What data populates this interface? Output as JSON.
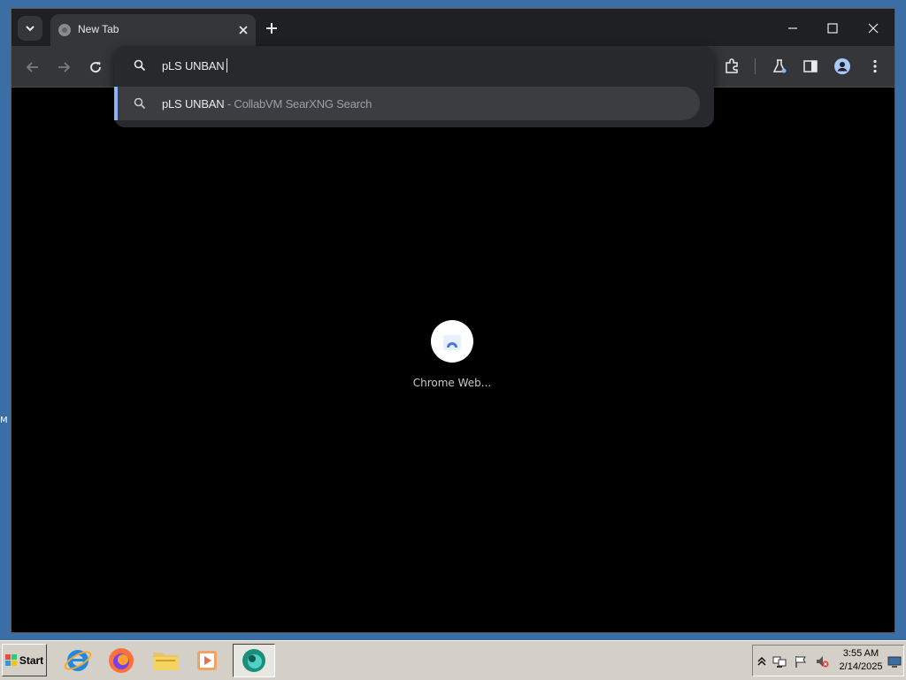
{
  "desktop": {
    "edge_text": "M"
  },
  "browser": {
    "tab": {
      "title": "New Tab"
    },
    "omnibox": {
      "value": "pLS UNBAN",
      "suggestion": {
        "query": "pLS UNBAN",
        "description": " - CollabVM SearXNG Search"
      }
    },
    "shortcut": {
      "label": "Chrome Web..."
    }
  },
  "taskbar": {
    "start_label": "Start",
    "clock": {
      "time": "3:55 AM",
      "date": "2/14/2025"
    }
  }
}
